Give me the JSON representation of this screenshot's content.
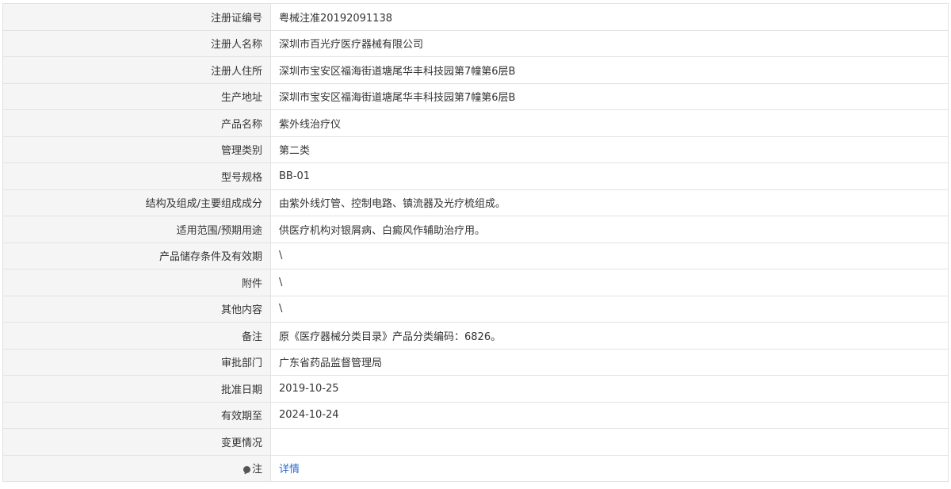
{
  "rows": [
    {
      "label": "注册证编号",
      "value": "粤械注准20192091138"
    },
    {
      "label": "注册人名称",
      "value": "深圳市百光疗医疗器械有限公司"
    },
    {
      "label": "注册人住所",
      "value": "深圳市宝安区福海街道塘尾华丰科技园第7幢第6层B"
    },
    {
      "label": "生产地址",
      "value": "深圳市宝安区福海街道塘尾华丰科技园第7幢第6层B"
    },
    {
      "label": "产品名称",
      "value": "紫外线治疗仪"
    },
    {
      "label": "管理类别",
      "value": "第二类"
    },
    {
      "label": "型号规格",
      "value": "BB-01"
    },
    {
      "label": "结构及组成/主要组成成分",
      "value": "由紫外线灯管、控制电路、镇流器及光疗梳组成。"
    },
    {
      "label": "适用范围/预期用途",
      "value": "供医疗机构对银屑病、白癜风作辅助治疗用。"
    },
    {
      "label": "产品储存条件及有效期",
      "value": "\\"
    },
    {
      "label": "附件",
      "value": "\\"
    },
    {
      "label": "其他内容",
      "value": "\\"
    },
    {
      "label": "备注",
      "value": "原《医疗器械分类目录》产品分类编码：6826。"
    },
    {
      "label": "审批部门",
      "value": "广东省药品监督管理局"
    },
    {
      "label": "批准日期",
      "value": "2019-10-25"
    },
    {
      "label": "有效期至",
      "value": "2024-10-24"
    },
    {
      "label": "变更情况",
      "value": ""
    }
  ],
  "note_row": {
    "label": "注",
    "icon": "pin-icon",
    "link_text": "详情",
    "link_color": "#2a6bd1"
  }
}
